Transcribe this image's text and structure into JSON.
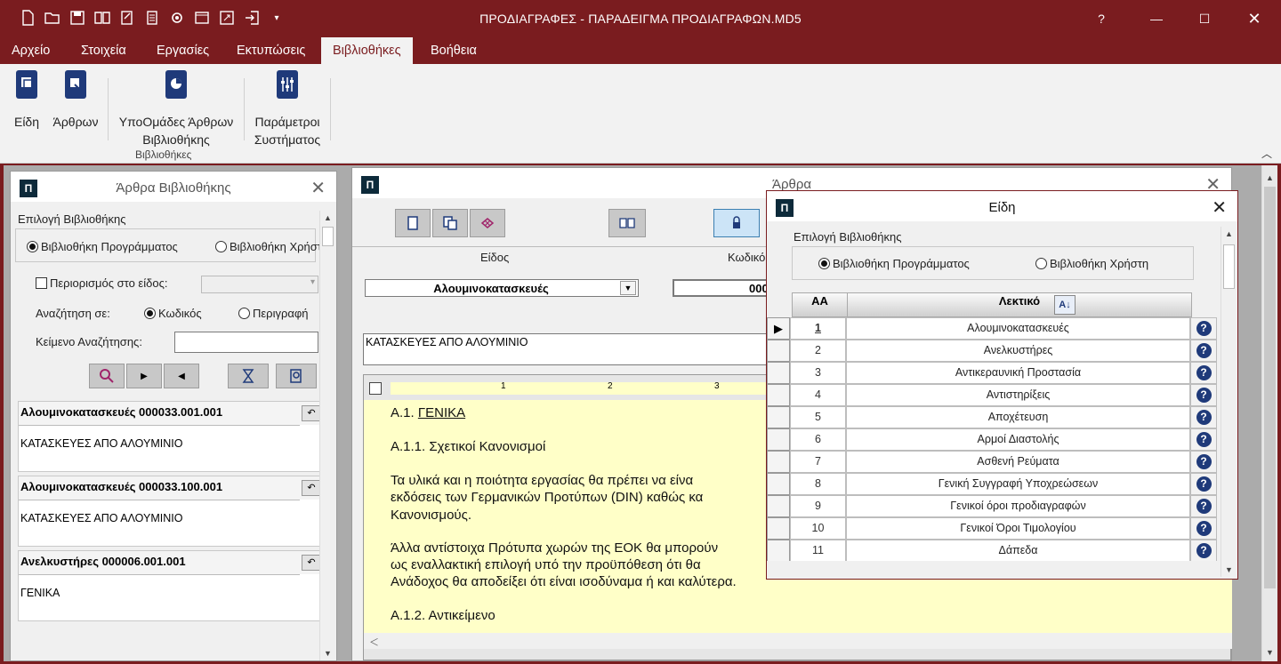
{
  "app": {
    "title": "ΠΡΟΔΙΑΓΡΑΦΕΣ - ΠΑΡΑΔΕΙΓΜΑ ΠΡΟΔΙΑΓΡΑΦΩΝ.MD5",
    "help": "?"
  },
  "menu": [
    "Αρχείο",
    "Στοιχεία",
    "Εργασίες",
    "Εκτυπώσεις",
    "Βιβλιοθήκες",
    "Βοήθεια"
  ],
  "ribbon": {
    "b1": "Είδη",
    "b2": "Άρθρων",
    "b3a": "ΥποΟμάδες Άρθρων",
    "b3b": "Βιβλιοθήκης",
    "b4a": "Παράμετροι",
    "b4b": "Συστήματος",
    "group": "Βιβλιοθήκες"
  },
  "left": {
    "title": "Άρθρα Βιβλιοθήκης",
    "select_lib": "Επιλογή Βιβλιοθήκης",
    "lib_program": "Βιβλιοθήκη Προγράμματος",
    "lib_user": "Βιβλιοθήκη Χρήστη",
    "restrict": "Περιορισμός στο είδος:",
    "search_in": "Αναζήτηση σε:",
    "opt_code": "Κωδικός",
    "opt_desc": "Περιγραφή",
    "search_text": "Κείμενο Αναζήτησης:",
    "records": [
      {
        "name": "Αλουμινοκατασκευές   000033.001.001",
        "desc": "ΚΑΤΑΣΚΕΥΕΣ ΑΠΟ ΑΛΟΥΜΙΝΙΟ"
      },
      {
        "name": "Αλουμινοκατασκευές   000033.100.001",
        "desc": "ΚΑΤΑΣΚΕΥΕΣ ΑΠΟ ΑΛΟΥΜΙΝΙΟ"
      },
      {
        "name": "Ανελκυστήρες   000006.001.001",
        "desc": "ΓΕΝΙΚΑ"
      }
    ]
  },
  "middle": {
    "title": "Άρθρα",
    "col_kind": "Είδος",
    "col_code": "Κωδικός",
    "kind_value": "Αλουμινοκατασκευές",
    "code_value": "000",
    "desc_value": "ΚΑΤΑΣΚΕΥΕΣ ΑΠΟ ΑΛΟΥΜΙΝΙΟ",
    "ruler": [
      "1",
      "2",
      "3"
    ],
    "doc": {
      "l1a": "Α.1. ",
      "l1b": "ΓΕΝΙΚΑ",
      "l2": "Α.1.1. Σχετικοί Κανονισμοί",
      "l3": "Τα υλικά και η ποιότητα εργασίας θα πρέπει να είνα",
      "l4": "εκδόσεις των Γερμανικών Προτύπων (DIN) καθώς κα",
      "l5": "Κανονισμούς.",
      "l6": "Άλλα αντίστοιχα Πρότυπα χωρών της ΕΟΚ θα μπορούν",
      "l7": "ως εναλλακτική επιλογή υπό την προϋπόθεση ότι θα",
      "l8": "Ανάδοχος θα αποδείξει ότι είναι ισοδύναμα ή και καλύτερα.",
      "l9": "Α.1.2. Αντικείμενο"
    }
  },
  "eidi": {
    "title": "Είδη",
    "select_lib": "Επιλογή Βιβλιοθήκης",
    "lib_program": "Βιβλιοθήκη Προγράμματος",
    "lib_user": "Βιβλιοθήκη Χρήστη",
    "col_aa": "ΑΑ",
    "col_lex": "Λεκτικό",
    "rows": [
      {
        "aa": "1",
        "lex": "Αλουμινοκατασκευές"
      },
      {
        "aa": "2",
        "lex": "Ανελκυστήρες"
      },
      {
        "aa": "3",
        "lex": "Αντικεραυνική Προστασία"
      },
      {
        "aa": "4",
        "lex": "Αντιστηρίξεις"
      },
      {
        "aa": "5",
        "lex": "Αποχέτευση"
      },
      {
        "aa": "6",
        "lex": "Αρμοί Διαστολής"
      },
      {
        "aa": "7",
        "lex": "Ασθενή Ρεύματα"
      },
      {
        "aa": "8",
        "lex": "Γενική Συγγραφή Υποχρεώσεων"
      },
      {
        "aa": "9",
        "lex": "Γενικοί όροι προδιαγραφών"
      },
      {
        "aa": "10",
        "lex": "Γενικοί Όροι Τιμολογίου"
      },
      {
        "aa": "11",
        "lex": "Δάπεδα"
      }
    ]
  },
  "colors": {
    "brand": "#7a1c1f",
    "doc_bg": "#ffffc8",
    "help_icon": "#1f3a7a"
  }
}
